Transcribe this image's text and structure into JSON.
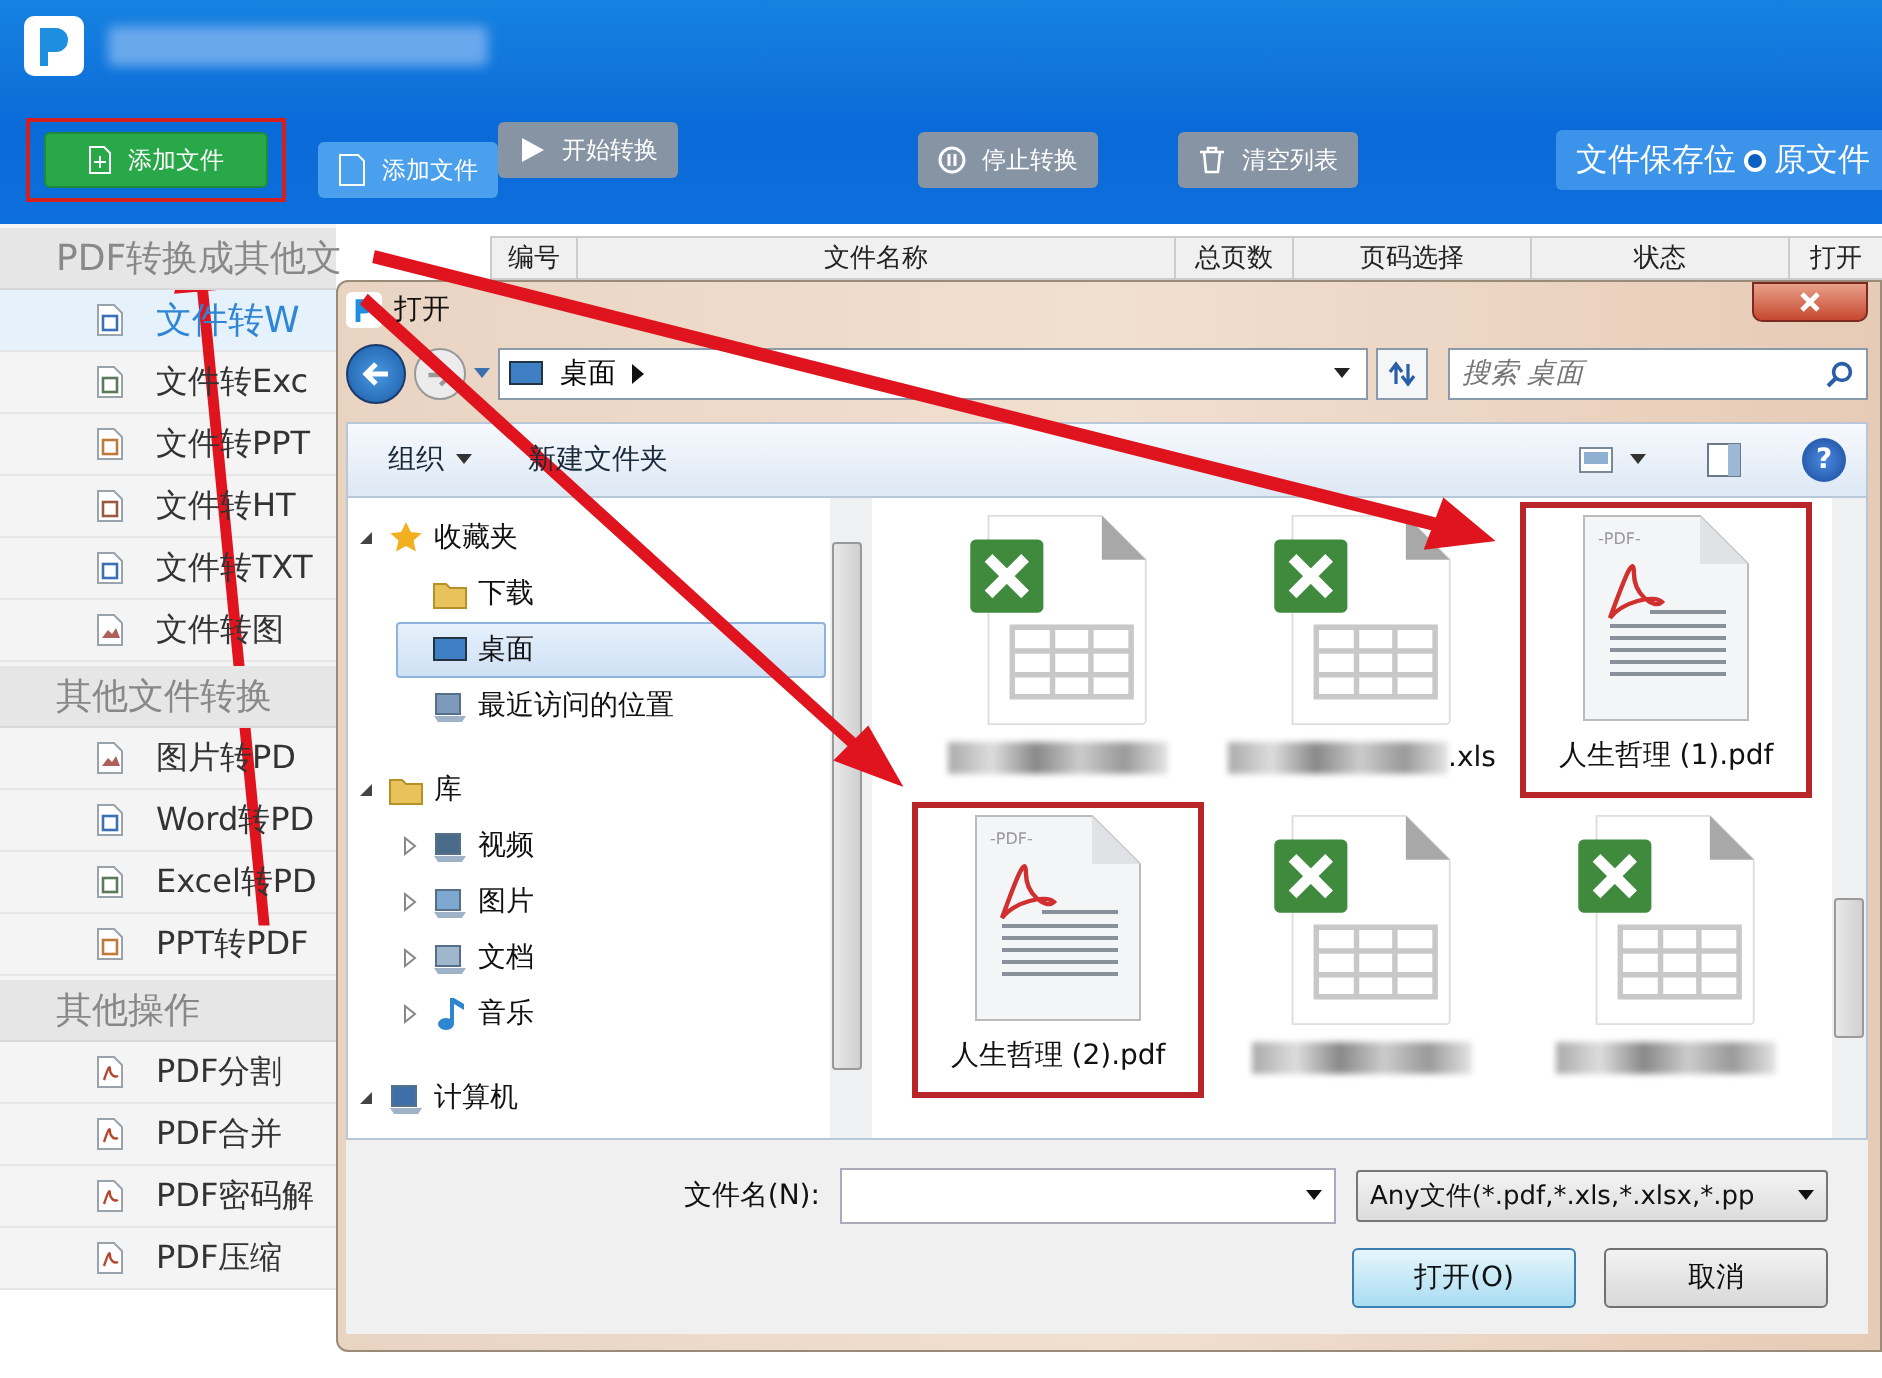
{
  "app": {
    "add_button": {
      "label": "添加文件",
      "annotated": true
    },
    "toolbar": [
      {
        "label": "添加文件",
        "kind": "add-folder",
        "disabled": false
      },
      {
        "label": "开始转换",
        "kind": "start",
        "disabled": true
      },
      {
        "label": "停止转换",
        "kind": "stop",
        "disabled": true
      },
      {
        "label": "清空列表",
        "kind": "clear",
        "disabled": true
      }
    ],
    "save_location": {
      "label": "文件保存位",
      "option": "原文件",
      "selected": true
    }
  },
  "sidebar": {
    "sections": [
      {
        "title": "PDF转换成其他文",
        "items": [
          {
            "label": "文件转W",
            "kind": "word",
            "selected": true
          },
          {
            "label": "文件转Exc",
            "kind": "excel",
            "selected": false
          },
          {
            "label": "文件转PPT",
            "kind": "ppt",
            "selected": false
          },
          {
            "label": "文件转HT",
            "kind": "html",
            "selected": false
          },
          {
            "label": "文件转TXT",
            "kind": "txt",
            "selected": false
          },
          {
            "label": "文件转图",
            "kind": "image",
            "selected": false
          }
        ]
      },
      {
        "title": "其他文件转换",
        "items": [
          {
            "label": "图片转PD",
            "kind": "image",
            "selected": false
          },
          {
            "label": "Word转PD",
            "kind": "word",
            "selected": false
          },
          {
            "label": "Excel转PD",
            "kind": "excel",
            "selected": false
          },
          {
            "label": "PPT转PDF",
            "kind": "ppt",
            "selected": false
          }
        ]
      },
      {
        "title": "其他操作",
        "items": [
          {
            "label": "PDF分割",
            "kind": "pdf",
            "selected": false
          },
          {
            "label": "PDF合并",
            "kind": "pdf",
            "selected": false
          },
          {
            "label": "PDF密码解",
            "kind": "pdf",
            "selected": false
          },
          {
            "label": "PDF压缩",
            "kind": "pdf",
            "selected": false
          }
        ]
      }
    ]
  },
  "table": {
    "columns": [
      "编号",
      "文件名称",
      "总页数",
      "页码选择",
      "状态",
      "打开"
    ]
  },
  "dialog": {
    "title": "打开",
    "address": "桌面",
    "search": {
      "placeholder": "搜索 桌面"
    },
    "toolbar": [
      {
        "label": "组织",
        "kind": "menu"
      },
      {
        "label": "新建文件夹",
        "kind": "plain"
      }
    ],
    "help": "?",
    "nav_tree": [
      {
        "label": "收藏夹",
        "kind": "favorites",
        "expanded": true,
        "selected": false,
        "children": [
          {
            "label": "下载",
            "kind": "download",
            "selected": false
          },
          {
            "label": "桌面",
            "kind": "desktop",
            "selected": true
          },
          {
            "label": "最近访问的位置",
            "kind": "recent",
            "selected": false
          }
        ]
      },
      {
        "label": "库",
        "kind": "library",
        "expanded": true,
        "selected": false,
        "children": [
          {
            "label": "视频",
            "kind": "video",
            "expanded": false,
            "selected": false
          },
          {
            "label": "图片",
            "kind": "picture",
            "expanded": false,
            "selected": false
          },
          {
            "label": "文档",
            "kind": "document",
            "expanded": false,
            "selected": false
          },
          {
            "label": "音乐",
            "kind": "music",
            "expanded": false,
            "selected": false
          }
        ]
      },
      {
        "label": "计算机",
        "kind": "computer",
        "expanded": true,
        "selected": false
      }
    ],
    "files": [
      {
        "kind": "xls",
        "redacted": true,
        "annotated": false
      },
      {
        "kind": "xls",
        "name": ".xls",
        "redacted": true,
        "annotated": false
      },
      {
        "kind": "pdf",
        "icon_label": "-PDF-",
        "name": "人生哲理 (1).pdf",
        "redacted": false,
        "annotated": true
      },
      {
        "kind": "pdf",
        "icon_label": "-PDF-",
        "name": "人生哲理 (2).pdf",
        "redacted": false,
        "annotated": true
      },
      {
        "kind": "xls",
        "redacted": true,
        "annotated": false
      },
      {
        "kind": "xls",
        "redacted": true,
        "annotated": false
      }
    ],
    "filename_label": "文件名(N):",
    "filter": "Any文件(*.pdf,*.xls,*.xlsx,*.pp",
    "buttons": [
      {
        "label": "打开(O)",
        "default": true
      },
      {
        "label": "取消",
        "default": false
      }
    ]
  }
}
